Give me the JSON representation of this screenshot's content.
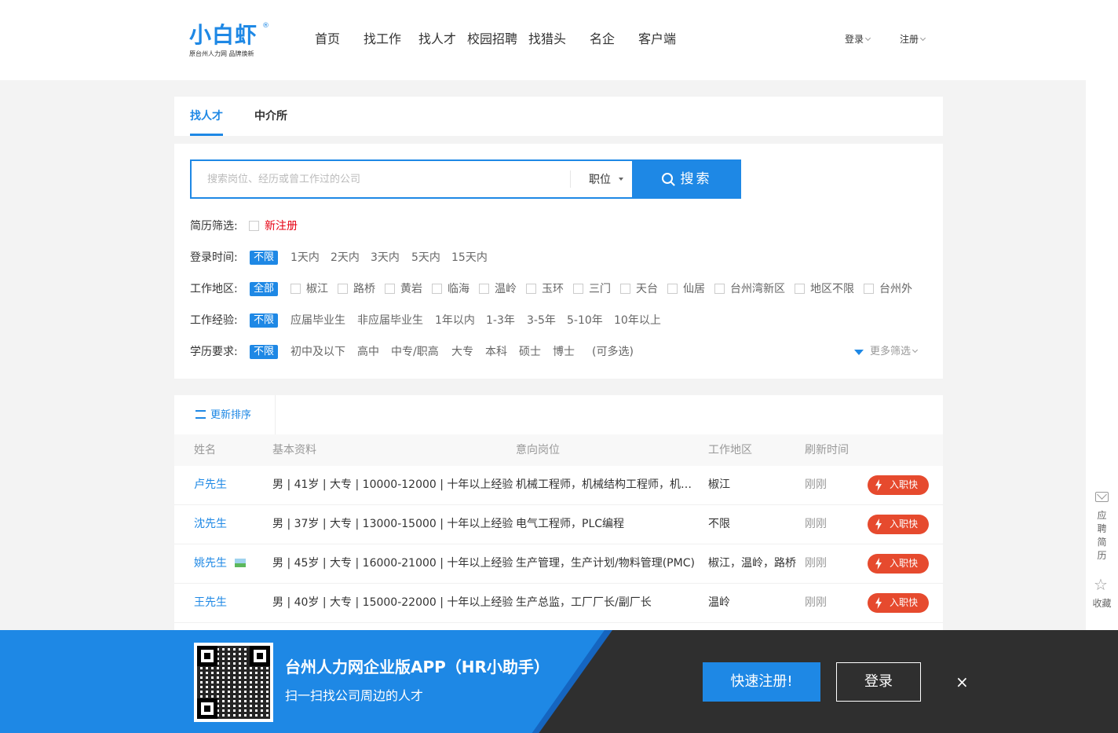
{
  "header": {
    "logo_text": "小白虾",
    "logo_reg": "®",
    "logo_sub": "原台州人力网  品牌焕新",
    "nav": [
      "首页",
      "找工作",
      "找人才",
      "校园招聘",
      "找猎头",
      "名企",
      "客户端"
    ],
    "login": "登录",
    "register": "注册"
  },
  "tabs": [
    "找人才",
    "中介所"
  ],
  "search": {
    "placeholder": "搜索岗位、经历或曾工作过的公司",
    "type": "职位",
    "button": "搜索"
  },
  "filters": {
    "resume": {
      "label": "简历筛选:",
      "option": "新注册"
    },
    "login_time": {
      "label": "登录时间:",
      "selected": "不限",
      "options": [
        "1天内",
        "2天内",
        "3天内",
        "5天内",
        "15天内"
      ]
    },
    "area": {
      "label": "工作地区:",
      "selected": "全部",
      "options": [
        "椒江",
        "路桥",
        "黄岩",
        "临海",
        "温岭",
        "玉环",
        "三门",
        "天台",
        "仙居",
        "台州湾新区",
        "地区不限",
        "台州外"
      ]
    },
    "experience": {
      "label": "工作经验:",
      "selected": "不限",
      "options": [
        "应届毕业生",
        "非应届毕业生",
        "1年以内",
        "1-3年",
        "3-5年",
        "5-10年",
        "10年以上"
      ]
    },
    "education": {
      "label": "学历要求:",
      "selected": "不限",
      "options": [
        "初中及以下",
        "高中",
        "中专/职高",
        "大专",
        "本科",
        "硕士",
        "博士"
      ],
      "note": "(可多选)"
    },
    "more": "更多筛选"
  },
  "list": {
    "sort": "更新排序",
    "columns": [
      "姓名",
      "基本资料",
      "意向岗位",
      "工作地区",
      "刷新时间"
    ],
    "rows": [
      {
        "name": "卢先生",
        "info": "男 | 41岁 | 大专 | 10000-12000 | 十年以上经验",
        "position": "机械工程师，机械结构工程师，机械设计",
        "area": "椒江",
        "time": "刚刚",
        "badge": "入职快"
      },
      {
        "name": "沈先生",
        "info": "男 | 37岁 | 大专 | 13000-15000 | 十年以上经验",
        "position": "电气工程师，PLC编程",
        "area": "不限",
        "time": "刚刚",
        "badge": "入职快"
      },
      {
        "name": "姚先生",
        "info": "男 | 45岁 | 大专 | 16000-21000 | 十年以上经验",
        "position": "生产管理，生产计划/物料管理(PMC)",
        "area": "椒江，温岭，路桥",
        "time": "刚刚",
        "badge": "入职快"
      },
      {
        "name": "王先生",
        "info": "男 | 40岁 | 大专 | 15000-22000 | 十年以上经验",
        "position": "生产总监，工厂厂长/副厂长",
        "area": "温岭",
        "time": "刚刚",
        "badge": "入职快"
      }
    ]
  },
  "sidebar": {
    "resume": [
      "应",
      "聘",
      "简",
      "历"
    ],
    "collect": "收藏"
  },
  "banner": {
    "title": "台州人力网企业版APP（HR小助手）",
    "subtitle": "扫一扫找公司周边的人才",
    "register": "快速注册!",
    "login": "登录",
    "close": "×"
  }
}
